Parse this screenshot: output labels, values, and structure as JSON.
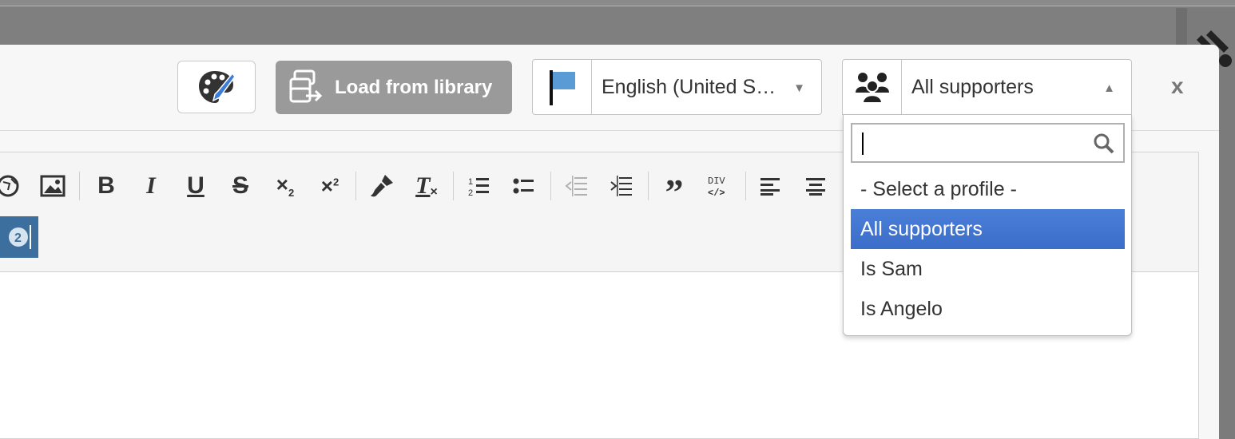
{
  "header": {
    "load_label": "Load from library",
    "language": {
      "value": "English (United S…"
    },
    "profile": {
      "value": "All supporters"
    },
    "close_label": "x"
  },
  "toolbar": {
    "buttons": [
      "globe",
      "image",
      "bold",
      "italic",
      "underline",
      "strikethrough",
      "subscript",
      "superscript",
      "format-painter",
      "clear-format",
      "ordered-list",
      "bullet-list",
      "outdent",
      "indent",
      "blockquote",
      "div",
      "align-left",
      "align-center"
    ]
  },
  "dropdown": {
    "search_placeholder": "",
    "options": [
      {
        "label": "- Select a profile -",
        "selected": false
      },
      {
        "label": "All supporters",
        "selected": true
      },
      {
        "label": "Is Sam",
        "selected": false
      },
      {
        "label": "Is Angelo",
        "selected": false
      }
    ]
  },
  "colors": {
    "selected_option": "#3b6dc9",
    "load_button": "#9a9a9a",
    "flag": "#5b9bd5"
  }
}
